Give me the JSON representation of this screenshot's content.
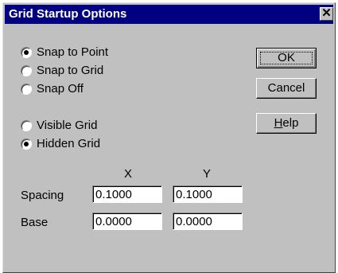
{
  "window": {
    "title": "Grid Startup Options",
    "close_glyph": "✕"
  },
  "snap_options": [
    {
      "label": "Snap to Point",
      "checked": true
    },
    {
      "label": "Snap to Grid",
      "checked": false
    },
    {
      "label": "Snap Off",
      "checked": false
    }
  ],
  "grid_options": [
    {
      "label": "Visible Grid",
      "checked": false
    },
    {
      "label": "Hidden Grid",
      "checked": true
    }
  ],
  "buttons": {
    "ok": "OK",
    "cancel": "Cancel",
    "help_accel": "H",
    "help_rest": "elp"
  },
  "table": {
    "col_x": "X",
    "col_y": "Y",
    "spacing_label": "Spacing",
    "base_label": "Base",
    "spacing_x": "0.1000",
    "spacing_y": "0.1000",
    "base_x": "0.0000",
    "base_y": "0.0000"
  }
}
